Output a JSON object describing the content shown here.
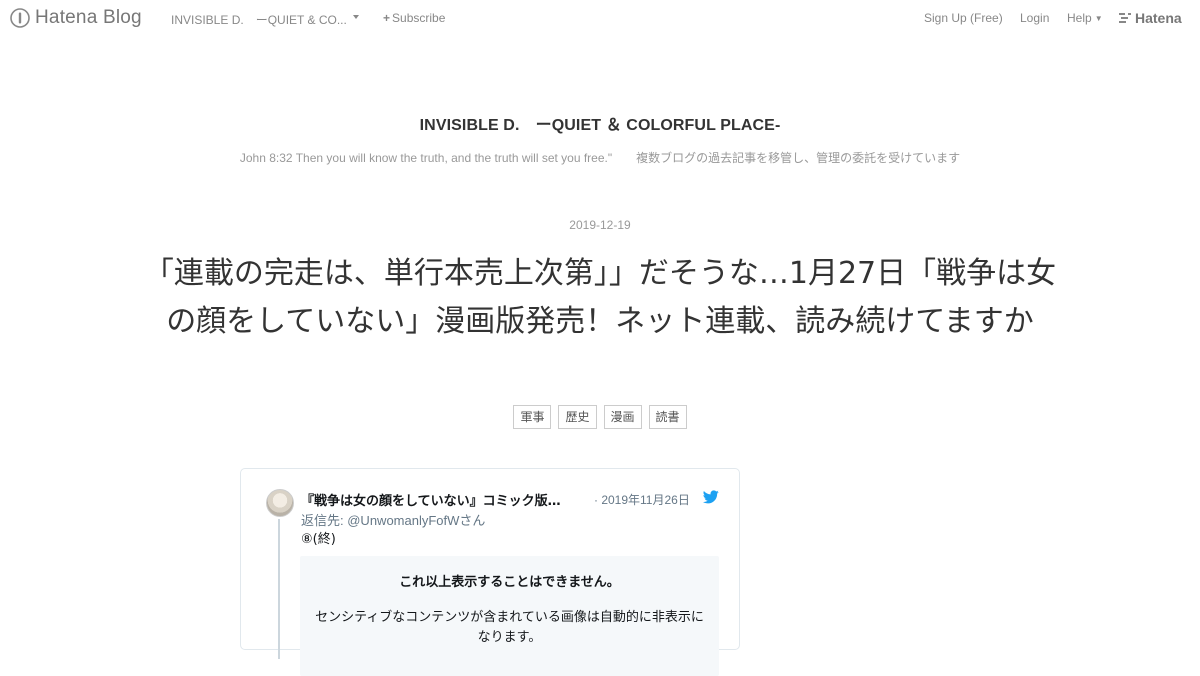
{
  "topbar": {
    "brand": "Hatena Blog",
    "blog_title_short": "INVISIBLE D.　ーQUIET & CO...",
    "subscribe": "Subscribe",
    "signup": "Sign Up (Free)",
    "login": "Login",
    "help": "Help",
    "hatena": "Hatena"
  },
  "header": {
    "title": "INVISIBLE D.　ーQUIET ＆ COLORFUL PLACE-",
    "description": "John 8:32 Then you will know the truth, and the truth will set you free.\"　　複数ブログの過去記事を移管し、管理の委託を受けています"
  },
  "entry": {
    "date": "2019-12-19",
    "title": "「連載の完走は、単行本売上次第」」だそうな…1月27日「戦争は女の顔をしていない」漫画版発売！ネット連載、読み続けてますか",
    "tags": [
      "軍事",
      "歴史",
      "漫画",
      "読書"
    ]
  },
  "tweet": {
    "name": "『戦争は女の顔をしていない』コミック版…",
    "date": "· 2019年11月26日",
    "reply_prefix": "返信先: ",
    "reply_handle": "@UnwomanlyFofWさん",
    "text": "⑧(終)",
    "warning_title": "これ以上表示することはできません。",
    "warning_body": "センシティブなコンテンツが含まれている画像は自動的に非表示になります。"
  },
  "colors": {
    "twitter_blue": "#1da1f2",
    "muted_text": "#888888"
  },
  "icons": [
    "hatena-blog-logo-icon",
    "caret-down-icon",
    "plus-icon",
    "hatena-logo-icon",
    "twitter-bird-icon"
  ]
}
